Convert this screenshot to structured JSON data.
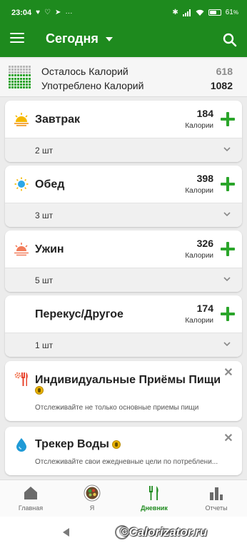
{
  "status_bar": {
    "time": "23:04",
    "battery": "61",
    "battery_unit": "%",
    "dots": "···"
  },
  "app_bar": {
    "title": "Сегодня"
  },
  "summary": {
    "remaining_label": "Осталось Калорий",
    "remaining_value": "618",
    "consumed_label": "Употреблено Калорий",
    "consumed_value": "1082"
  },
  "meals": [
    {
      "name": "Завтрак",
      "kcal": "184",
      "unit": "Калории",
      "count": "2 шт",
      "icon": "sunrise-icon"
    },
    {
      "name": "Обед",
      "kcal": "398",
      "unit": "Калории",
      "count": "3 шт",
      "icon": "sun-icon"
    },
    {
      "name": "Ужин",
      "kcal": "326",
      "unit": "Калории",
      "count": "5 шт",
      "icon": "sunset-icon"
    },
    {
      "name": "Перекус/Другое",
      "kcal": "174",
      "unit": "Калории",
      "count": "1 шт",
      "icon": "moon-icon"
    }
  ],
  "promos": [
    {
      "title": "Индивидуальные Приёмы Пищи",
      "desc": "Отслеживайте не только основные приемы пищи",
      "close": "✕"
    },
    {
      "title": "Трекер Воды",
      "desc": "Отслеживайте свои ежедневные цели по потреблени...",
      "close": "✕"
    }
  ],
  "bottom_nav": {
    "home": "Главная",
    "me": "Я",
    "diary": "Дневник",
    "reports": "Отчеты"
  },
  "watermark": "©Calorizator.ru",
  "colors": {
    "brand_green": "#1e8a1e",
    "add_green": "#2aa52a",
    "coin": "#e8b100"
  }
}
